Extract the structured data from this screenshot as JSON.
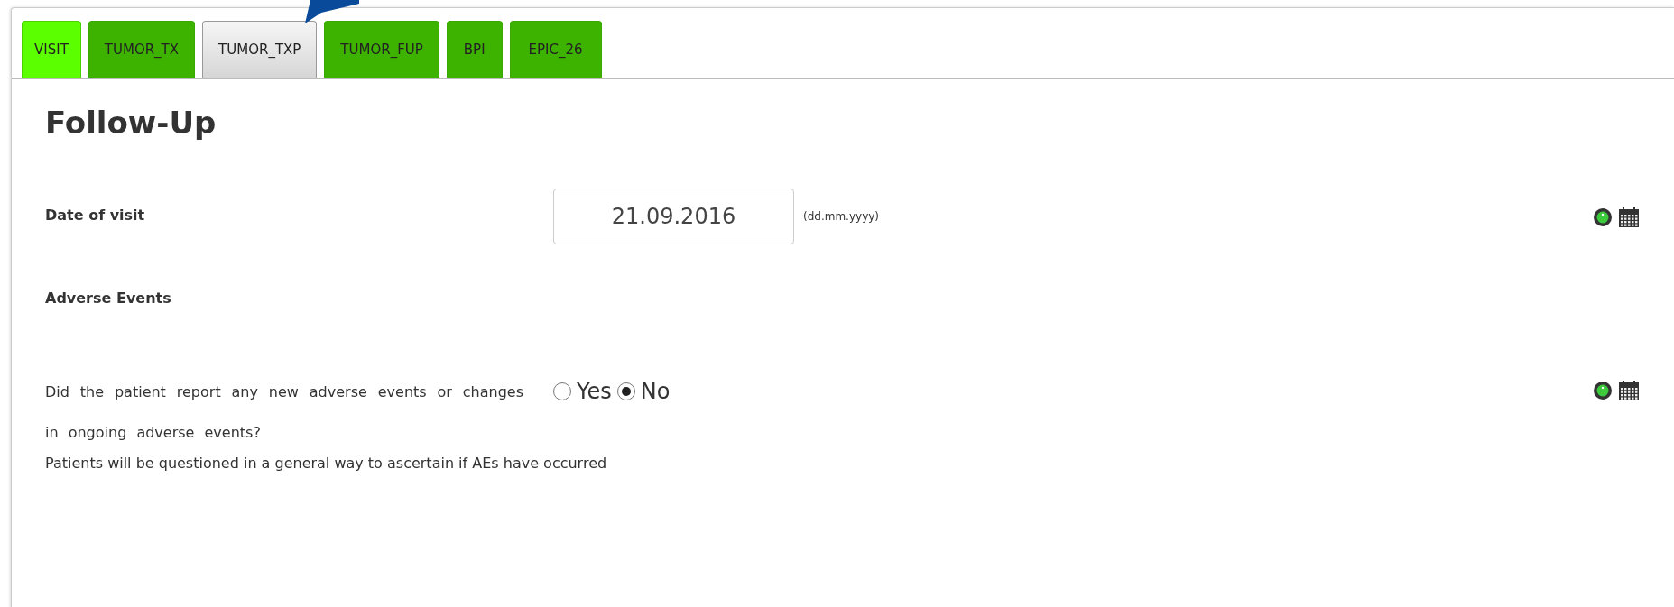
{
  "tabs": [
    {
      "label": "VISIT",
      "selected": true,
      "disabled": false
    },
    {
      "label": "TUMOR_TX",
      "selected": false,
      "disabled": false
    },
    {
      "label": "TUMOR_TXP",
      "selected": false,
      "disabled": true
    },
    {
      "label": "TUMOR_FUP",
      "selected": false,
      "disabled": false
    },
    {
      "label": "BPI",
      "selected": false,
      "disabled": false
    },
    {
      "label": "EPIC_26",
      "selected": false,
      "disabled": false
    }
  ],
  "heading": "Follow-Up",
  "fields": [
    {
      "kind": "date",
      "label": "Date of visit",
      "value": "21.09.2016",
      "hint": "(dd.mm.yyyy)"
    },
    {
      "kind": "section",
      "label": "Adverse Events"
    },
    {
      "kind": "radio",
      "label": "Did the patient report any new adverse events or changes in ongoing adverse events?",
      "options": [
        {
          "label": "Yes",
          "selected": false
        },
        {
          "label": "No",
          "selected": true
        }
      ],
      "note": "Patients will be questioned in a general way to ascertain if AEs have occurred"
    }
  ]
}
